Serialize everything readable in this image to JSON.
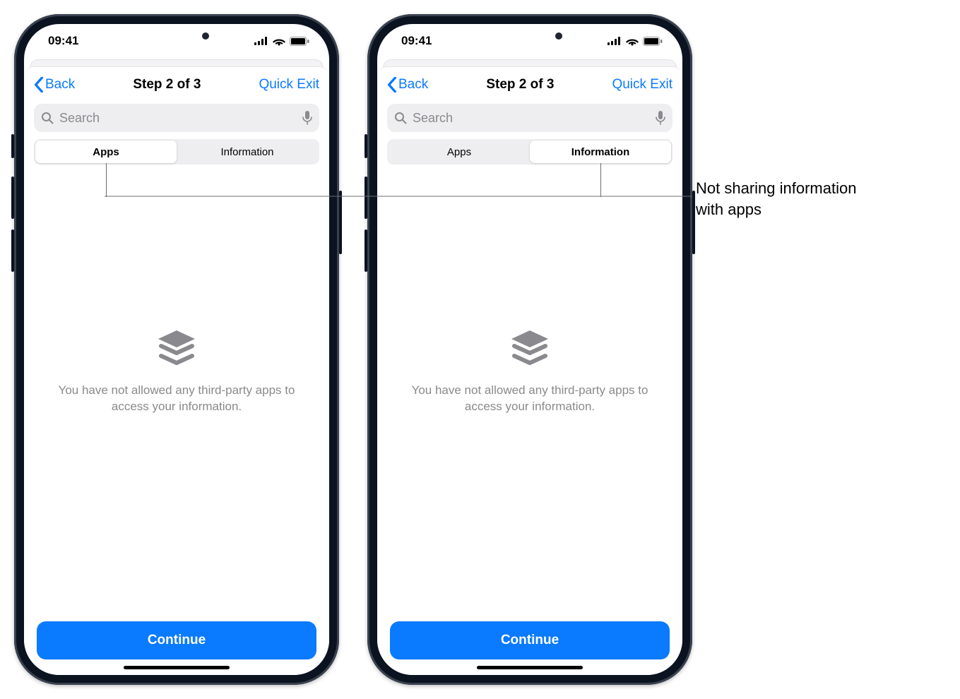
{
  "status": {
    "time": "09:41"
  },
  "nav": {
    "back_label": "Back",
    "title": "Step 2 of 3",
    "quick_exit_label": "Quick Exit"
  },
  "search": {
    "placeholder": "Search"
  },
  "segments": {
    "apps_label": "Apps",
    "information_label": "Information"
  },
  "empty_state": {
    "message": "You have not allowed any third-party apps to access your information."
  },
  "continue_label": "Continue",
  "callout": {
    "line1": "Not sharing information",
    "line2": "with apps"
  },
  "phones": [
    {
      "selected_segment": "apps"
    },
    {
      "selected_segment": "information"
    }
  ]
}
